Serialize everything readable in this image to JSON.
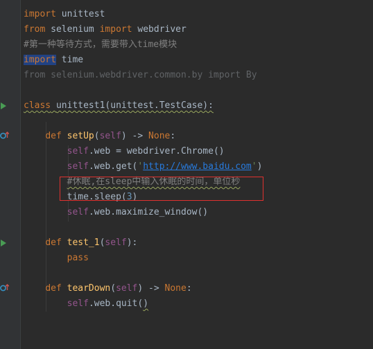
{
  "colors": {
    "background": "#2b2b2b",
    "keyword": "#cc7832",
    "function": "#ffc66d",
    "self": "#94558d",
    "comment": "#808080",
    "string": "#6a8759",
    "url": "#287bde",
    "number": "#6897bb",
    "highlight_box": "#e0312f"
  },
  "gutter_icons": [
    "run-icon",
    "override-icon"
  ],
  "editor": {
    "l1": {
      "kw": "import",
      "rest": " unittest"
    },
    "l2": {
      "kw1": "from",
      "mod": " selenium ",
      "kw2": "import",
      "rest": " webdriver"
    },
    "l3": {
      "comment": "#第一种等待方式，需要带入time模块"
    },
    "l4": {
      "kw": "import",
      "rest": " time"
    },
    "l5": {
      "text": "from selenium.webdriver.common.by import By"
    },
    "l7": {
      "kw": "class",
      "name": "unittest1",
      "rest": "(unittest.TestCase):"
    },
    "l9": {
      "kw": "def",
      "name": "setUp",
      "open": "(",
      "self": "self",
      "mid": ") -> ",
      "none": "None",
      "end": ":"
    },
    "l10": {
      "self": "self",
      "rest": ".web = webdriver.Chrome()"
    },
    "l11": {
      "self": "self",
      "mid": ".web.get(",
      "q1": "'",
      "url": "http://www.baidu.com",
      "q2": "'",
      "end": ")"
    },
    "l12": {
      "comment": "#休眠,在sleep中输入休眠的时间，单位秒"
    },
    "l13": {
      "pre": "time.sleep(",
      "num": "3",
      "end": ")"
    },
    "l14": {
      "self": "self",
      "rest": ".web.maximize_window()"
    },
    "l16": {
      "kw": "def",
      "name": "test_1",
      "open": "(",
      "self": "self",
      "end": "):"
    },
    "l17": {
      "kw": "pass"
    },
    "l19": {
      "kw": "def",
      "name": "tearDown",
      "open": "(",
      "self": "self",
      "mid": ") -> ",
      "none": "None",
      "end": ":"
    },
    "l20": {
      "self": "self",
      "mid": ".web.quit(",
      "end": ")"
    }
  }
}
